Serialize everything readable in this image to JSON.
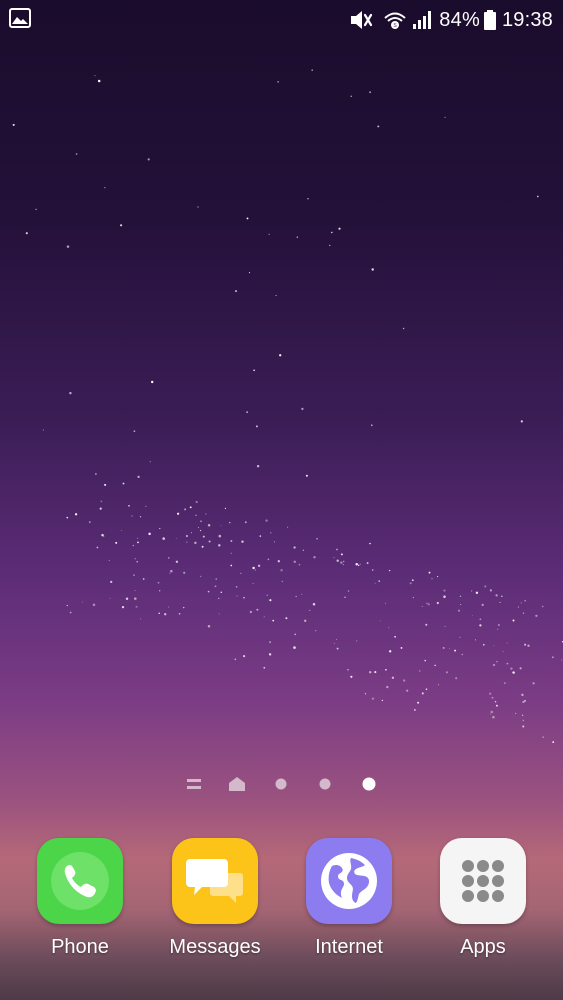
{
  "status_bar": {
    "notification_icon": "image-icon",
    "icons": [
      "mute-icon",
      "wifi-calling-icon",
      "signal-icon",
      "battery-icon"
    ],
    "battery": "84%",
    "clock": "19:38"
  },
  "page_indicator": {
    "items": [
      "apps-list-icon",
      "home-icon",
      "page-dot",
      "page-dot",
      "page-dot-active"
    ],
    "active_index": 4
  },
  "dock": {
    "apps": [
      {
        "label": "Phone",
        "icon": "phone-icon",
        "color": "#4cd548"
      },
      {
        "label": "Messages",
        "icon": "messages-icon",
        "color": "#fcc419"
      },
      {
        "label": "Internet",
        "icon": "globe-icon",
        "color": "#8d7bf0"
      },
      {
        "label": "Apps",
        "icon": "apps-grid-icon",
        "color": "#f5f5f5"
      }
    ]
  }
}
